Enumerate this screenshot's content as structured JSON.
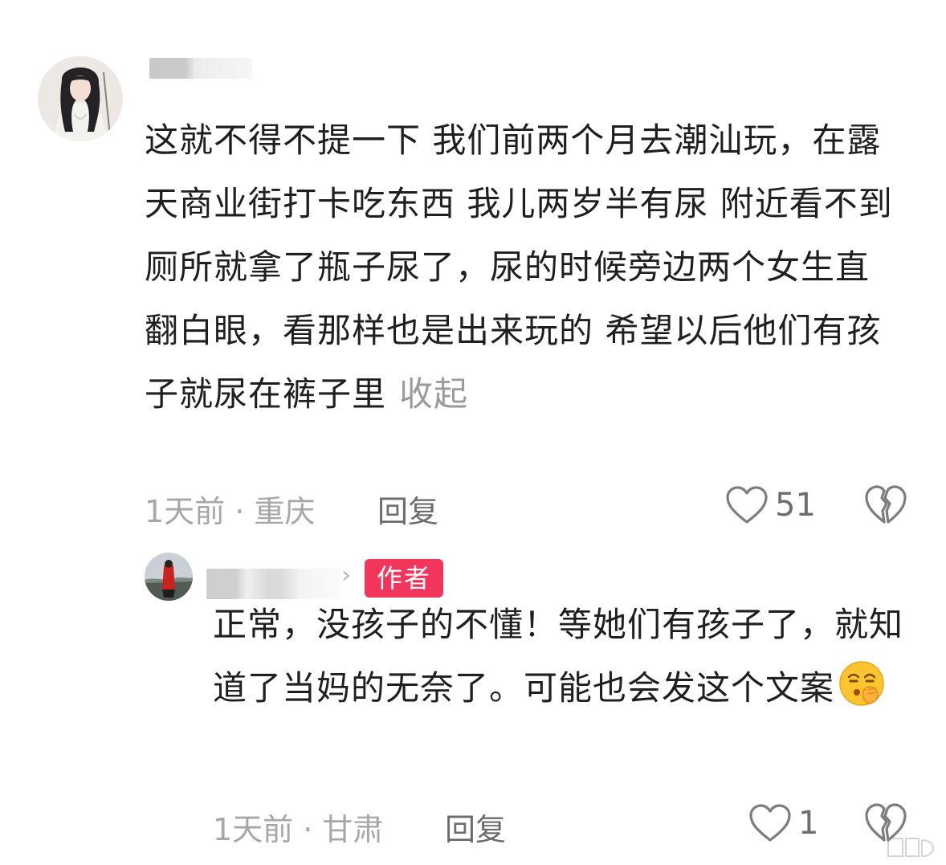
{
  "comment": {
    "text": "这就不得不提一下 我们前两个月去潮汕玩，在露天商业街打卡吃东西 我儿两岁半有尿 附近看不到厕所就拿了瓶子尿了，尿的时候旁边两个女生直翻白眼，看那样也是出来玩的 希望以后他们有孩子就尿在裤子里",
    "collapse_label": "收起",
    "meta": "1天前 · 重庆",
    "reply_label": "回复",
    "like_count": "51",
    "icons": [
      "avatar",
      "heart-icon",
      "broken-heart-icon"
    ]
  },
  "reply": {
    "badge": "作者",
    "text": "正常，没孩子的不懂！等她们有孩子了，就知道了当妈的无奈了。可能也会发这个文案",
    "emoji": "shush-face-emoji",
    "meta": "1天前 · 甘肃",
    "reply_label": "回复",
    "like_count": "1",
    "icons": [
      "avatar",
      "chevron-right-icon",
      "heart-icon",
      "broken-heart-icon"
    ]
  },
  "colors": {
    "text": "#1f1f1f",
    "meta": "#a7a7a7",
    "reply": "#6d6d6d",
    "author_badge": "#f2355b"
  }
}
